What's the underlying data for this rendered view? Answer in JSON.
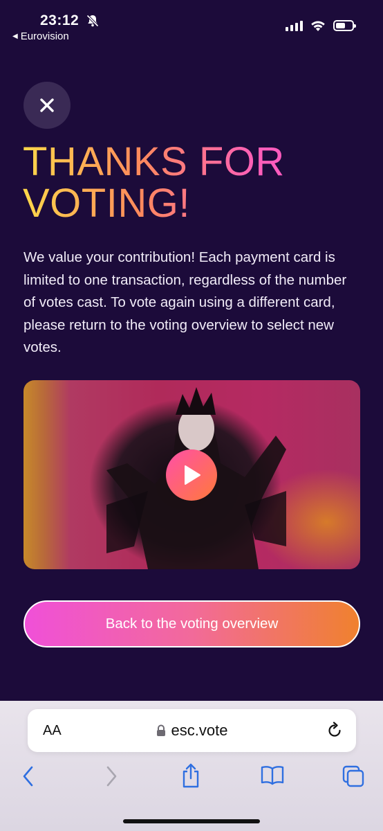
{
  "status_bar": {
    "time": "23:12",
    "back_app": "Eurovision",
    "battery_level": 0.58
  },
  "page": {
    "title": "THANKS FOR VOTING!",
    "body": "We value your contribution! Each payment card is limited to one transaction, regardless of the number of votes cast. To vote again using a different card, please return to the voting overview to select new votes.",
    "cta_label": "Back to the voting overview"
  },
  "browser": {
    "aa_label": "AA",
    "url": "esc.vote"
  },
  "colors": {
    "background": "#1c0b3a",
    "accent_pink": "#f050d8",
    "accent_orange": "#f0812e",
    "title_yellow": "#ffd84a"
  },
  "icons": {
    "close": "close-icon",
    "play": "play-icon",
    "lock": "lock-icon",
    "reload": "reload-icon",
    "back": "chevron-left-icon",
    "forward": "chevron-right-icon",
    "share": "share-icon",
    "bookmarks": "book-icon",
    "tabs": "tabs-icon"
  }
}
